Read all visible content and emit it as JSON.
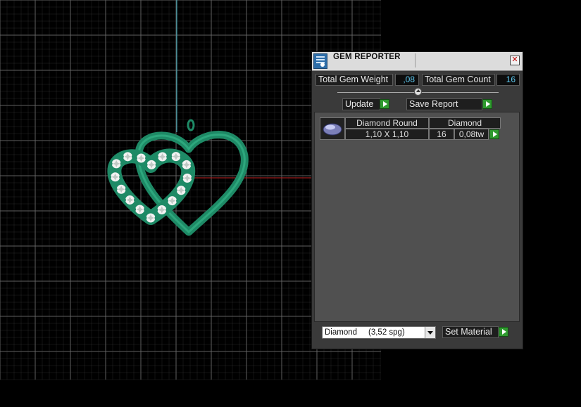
{
  "viewport": {
    "grid_color": "#6a6a6a",
    "axis_colors": {
      "vertical": "#3fb8c8",
      "horizontal": "#c02020"
    },
    "model_color": "#1e8a66",
    "gem_color": "#f2f2f2"
  },
  "panel": {
    "title": "GEM REPORTER",
    "close_glyph": "✕",
    "total_gem_weight_label": "Total Gem Weight",
    "total_gem_weight_value": ",08",
    "total_gem_count_label": "Total Gem Count",
    "total_gem_count_value": "16",
    "update_label": "Update",
    "save_report_label": "Save Report",
    "gems": [
      {
        "shape": "Diamond Round",
        "size": "1,10 X 1,10",
        "material": "Diamond",
        "count": "16",
        "weight": "0,08tw"
      }
    ],
    "material_select": "Diamond     (3,52 spg)",
    "set_material_label": "Set Material"
  }
}
